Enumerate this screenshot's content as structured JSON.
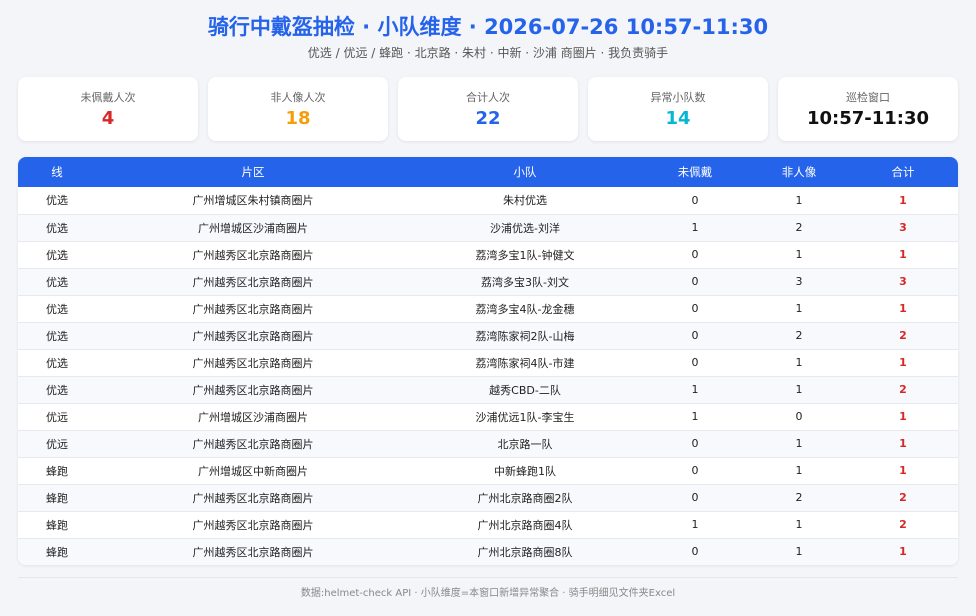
{
  "header": {
    "title": "骑行中戴盔抽检 · 小队维度 · 2026-07-26 10:57-11:30",
    "subtitle": "优选 / 优远 / 蜂跑 · 北京路 · 朱村 · 中新 · 沙浦 商圈片 · 我负责骑手"
  },
  "cards": [
    {
      "label": "未佩戴人次",
      "value": "4",
      "color": "#d62828"
    },
    {
      "label": "非人像人次",
      "value": "18",
      "color": "#f59e0b"
    },
    {
      "label": "合计人次",
      "value": "22",
      "color": "#2563eb"
    },
    {
      "label": "异常小队数",
      "value": "14",
      "color": "#06b6d4"
    },
    {
      "label": "巡检窗口",
      "value": "10:57-11:30",
      "color": "#111111"
    }
  ],
  "table": {
    "columns": [
      "线",
      "片区",
      "小队",
      "未佩戴",
      "非人像",
      "合计"
    ],
    "rows": [
      [
        "优选",
        "广州增城区朱村镇商圈片",
        "朱村优选",
        "0",
        "1",
        "1"
      ],
      [
        "优选",
        "广州增城区沙浦商圈片",
        "沙浦优选-刘洋",
        "1",
        "2",
        "3"
      ],
      [
        "优选",
        "广州越秀区北京路商圈片",
        "荔湾多宝1队-钟健文",
        "0",
        "1",
        "1"
      ],
      [
        "优选",
        "广州越秀区北京路商圈片",
        "荔湾多宝3队-刘文",
        "0",
        "3",
        "3"
      ],
      [
        "优选",
        "广州越秀区北京路商圈片",
        "荔湾多宝4队-龙金穗",
        "0",
        "1",
        "1"
      ],
      [
        "优选",
        "广州越秀区北京路商圈片",
        "荔湾陈家祠2队-山梅",
        "0",
        "2",
        "2"
      ],
      [
        "优选",
        "广州越秀区北京路商圈片",
        "荔湾陈家祠4队-市建",
        "0",
        "1",
        "1"
      ],
      [
        "优选",
        "广州越秀区北京路商圈片",
        "越秀CBD-二队",
        "1",
        "1",
        "2"
      ],
      [
        "优远",
        "广州增城区沙浦商圈片",
        "沙浦优远1队-李宝生",
        "1",
        "0",
        "1"
      ],
      [
        "优远",
        "广州越秀区北京路商圈片",
        "北京路一队",
        "0",
        "1",
        "1"
      ],
      [
        "蜂跑",
        "广州增城区中新商圈片",
        "中新蜂跑1队",
        "0",
        "1",
        "1"
      ],
      [
        "蜂跑",
        "广州越秀区北京路商圈片",
        "广州北京路商圈2队",
        "0",
        "2",
        "2"
      ],
      [
        "蜂跑",
        "广州越秀区北京路商圈片",
        "广州北京路商圈4队",
        "1",
        "1",
        "2"
      ],
      [
        "蜂跑",
        "广州越秀区北京路商圈片",
        "广州北京路商圈8队",
        "0",
        "1",
        "1"
      ]
    ]
  },
  "footer": "数据:helmet-check API · 小队维度=本窗口新增异常聚合 · 骑手明细见文件夹Excel"
}
